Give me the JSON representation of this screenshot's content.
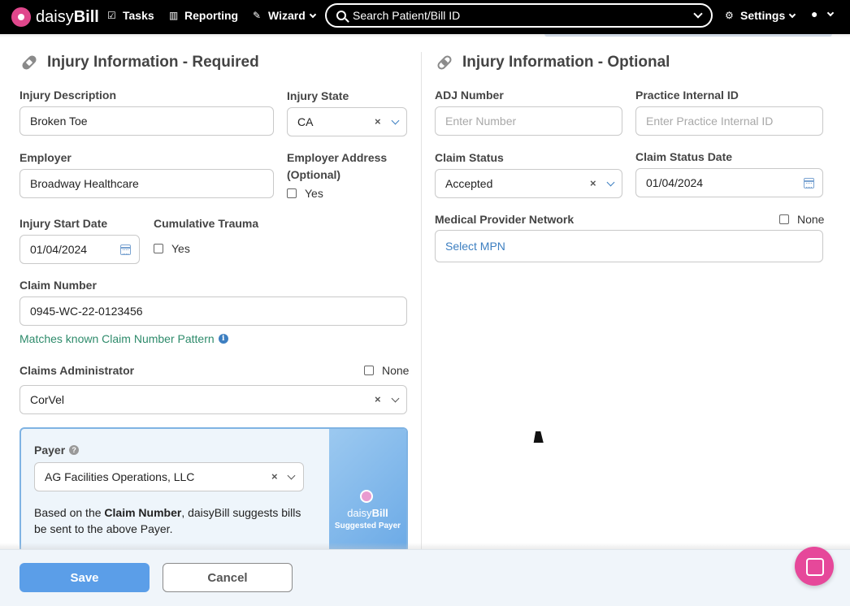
{
  "nav": {
    "brand_prefix": "daisy",
    "brand_suffix": "Bill",
    "tasks": "Tasks",
    "reporting": "Reporting",
    "wizard": "Wizard",
    "search_placeholder": "Search Patient/Bill ID",
    "settings": "Settings"
  },
  "required": {
    "title": "Injury Information - Required",
    "injury_description_label": "Injury Description",
    "injury_description_value": "Broken Toe",
    "injury_state_label": "Injury State",
    "injury_state_value": "CA",
    "employer_label": "Employer",
    "employer_value": "Broadway Healthcare",
    "employer_address_label_1": "Employer Address",
    "employer_address_label_2": "(Optional)",
    "employer_address_check": "Yes",
    "injury_start_date_label": "Injury Start Date",
    "injury_start_date_value": "01/04/2024",
    "cumulative_trauma_label": "Cumulative Trauma",
    "cumulative_trauma_check": "Yes",
    "claim_number_label": "Claim Number",
    "claim_number_value": "0945-WC-22-0123456",
    "claim_match_text": "Matches known Claim Number Pattern",
    "claims_admin_label": "Claims Administrator",
    "claims_admin_none": "None",
    "claims_admin_value": "CorVel",
    "payer_label": "Payer",
    "payer_value": "AG Facilities Operations, LLC",
    "payer_text_1": "Based on the ",
    "payer_text_bold": "Claim Number",
    "payer_text_2": ", daisyBill suggests bills be sent to the above Payer.",
    "suggested_brand_prefix": "daisy",
    "suggested_brand_suffix": "Bill",
    "suggested_label": "Suggested Payer"
  },
  "optional": {
    "title": "Injury Information - Optional",
    "adj_label": "ADJ Number",
    "adj_placeholder": "Enter Number",
    "internal_id_label": "Practice Internal ID",
    "internal_id_placeholder": "Enter Practice Internal ID",
    "claim_status_label": "Claim Status",
    "claim_status_value": "Accepted",
    "claim_status_date_label": "Claim Status Date",
    "claim_status_date_value": "01/04/2024",
    "mpn_label": "Medical Provider Network",
    "mpn_none": "None",
    "mpn_placeholder": "Select MPN"
  },
  "footer": {
    "save": "Save",
    "cancel": "Cancel"
  },
  "colors": {
    "accent": "#5b9ee8",
    "link": "#3d7fc1",
    "success": "#2e8b6b",
    "chat": "#e6489a"
  }
}
